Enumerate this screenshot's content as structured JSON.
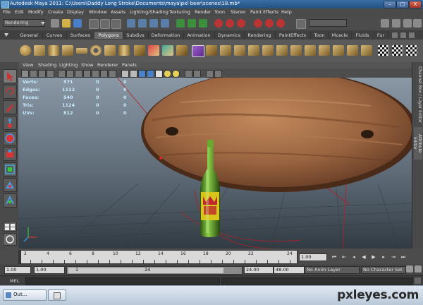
{
  "window": {
    "title": "Autodesk Maya 2011: C:\\Users\\Daddy Long Stroke\\Documents\\maya\\pxl beer\\scenes\\18.mb*",
    "minimize": "–",
    "maximize": "□",
    "close": "X"
  },
  "menu": [
    "File",
    "Edit",
    "Modify",
    "Create",
    "Display",
    "Window",
    "Assets",
    "Lighting/Shading",
    "Texturing",
    "Render",
    "Toon",
    "Stereo",
    "Paint Effects",
    "Help"
  ],
  "statusline": {
    "mode": "Rendering"
  },
  "shelf_tabs": [
    "General",
    "Curves",
    "Surfaces",
    "Polygons",
    "Subdivs",
    "Deformation",
    "Animation",
    "Dynamics",
    "Rendering",
    "PaintEffects",
    "Toon",
    "Muscle",
    "Fluids",
    "Fur"
  ],
  "active_shelf_tab": "Polygons",
  "panel_menu": [
    "View",
    "Shading",
    "Lighting",
    "Show",
    "Renderer",
    "Panels"
  ],
  "hud": {
    "rows": [
      {
        "label": "Verts:",
        "v1": "571",
        "v2": "0",
        "v3": "0"
      },
      {
        "label": "Edges:",
        "v1": "1112",
        "v2": "0",
        "v3": "0"
      },
      {
        "label": "Faces:",
        "v1": "540",
        "v2": "0",
        "v3": "0"
      },
      {
        "label": "Tris:",
        "v1": "1124",
        "v2": "0",
        "v3": "0"
      },
      {
        "label": "UVs:",
        "v1": "812",
        "v2": "0",
        "v3": "0"
      }
    ]
  },
  "side_tabs": [
    "Channel Box / Layer Editor",
    "Attribute Editor"
  ],
  "timeline": {
    "ticks": [
      "2",
      "4",
      "6",
      "8",
      "10",
      "12",
      "14",
      "16",
      "18",
      "20",
      "22",
      "24"
    ],
    "current_frame": "1.00"
  },
  "range": {
    "start_time": "1.00",
    "start_playback": "1.00",
    "range_start": "1",
    "range_end": "24",
    "end_playback": "24.00",
    "end_time": "48.00",
    "anim_layer": "No Anim Layer",
    "character_set": "No Character Set"
  },
  "cmdline": {
    "label": "MEL"
  },
  "taskbar": {
    "item": "Out...",
    "watermark": "pxleyes.com"
  },
  "colors": {
    "wood": "#9a6440",
    "bottle": "#4f8f1e",
    "label": "#d8c51a",
    "label_red": "#c0272d"
  }
}
